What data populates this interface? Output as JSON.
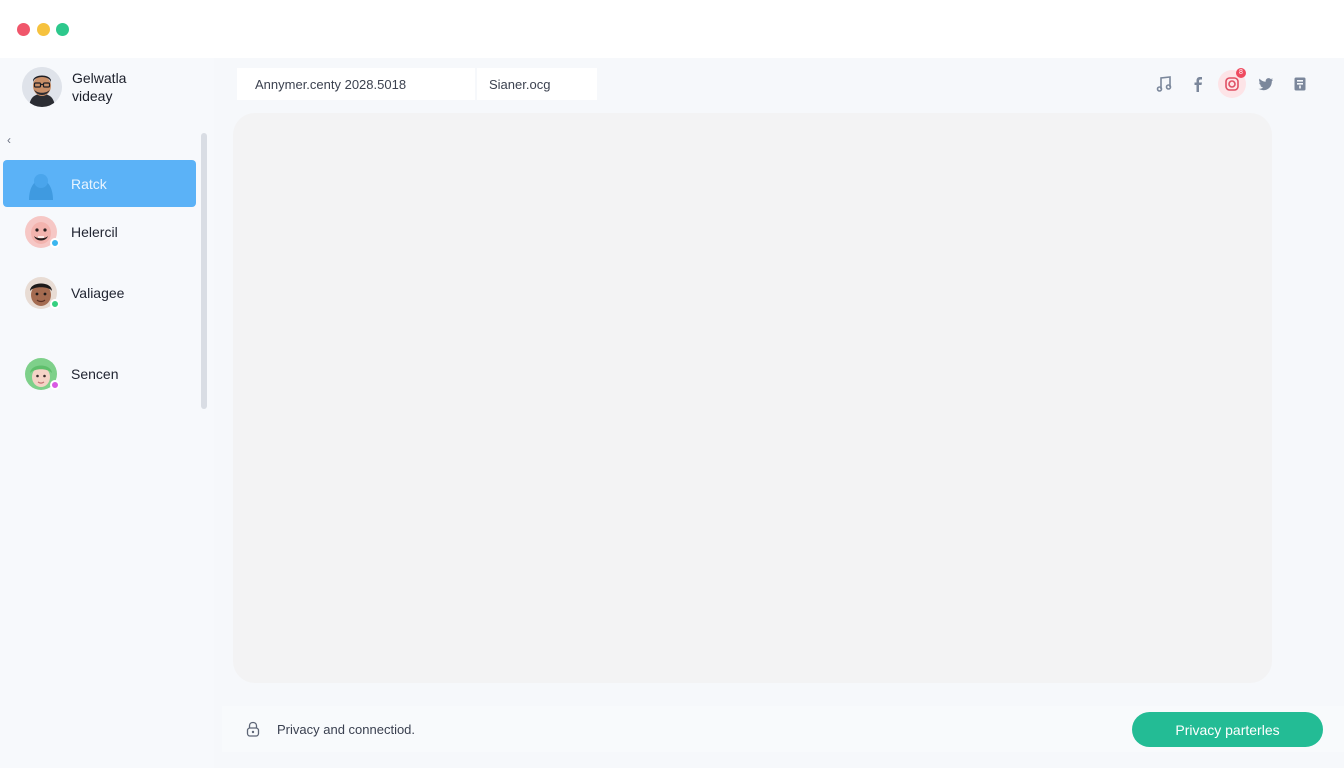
{
  "window": {
    "controls": [
      "close",
      "minimize",
      "maximize"
    ]
  },
  "profile": {
    "name_line1": "Gelwatla",
    "name_line2": "videay"
  },
  "sidebar": {
    "collapse_glyph": "‹",
    "contacts": [
      {
        "label": "Ratck",
        "active": true,
        "avatar_color": "#5bb2f7"
      },
      {
        "label": "Helercil",
        "status_color": "#3bb6ef",
        "avatar_color": "#f6c7c5"
      },
      {
        "label": "Valiagee",
        "status_color": "#35d07f",
        "avatar_color": "#a46b50"
      },
      {
        "label": "Sencen",
        "status_color": "#d95ae3",
        "avatar_color": "#7ed08a"
      }
    ]
  },
  "topbar": {
    "field1": "Annymer.centy 2028.5018",
    "field2": "Sianer.ocg",
    "social_icons": [
      "music-note-icon",
      "facebook-icon",
      "instagram-icon",
      "twitter-icon",
      "bookmark-icon"
    ],
    "notification_badge": "8"
  },
  "footer": {
    "status_text": "Privacy and connectiod.",
    "cta_label": "Privacy parterles"
  },
  "colors": {
    "accent_blue": "#5bb2f7",
    "cta_green": "#23bc95",
    "panel_bg": "#f3f3f4"
  }
}
